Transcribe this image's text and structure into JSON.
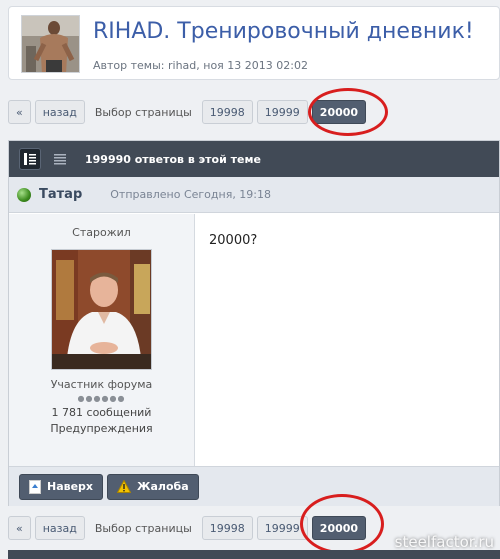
{
  "topic": {
    "title": "RIHAD. Тренировочный дневник!",
    "meta": "Автор темы: rihad, ноя 13 2013 02:02"
  },
  "pagination": {
    "first": "«",
    "prev": "назад",
    "label": "Выбор страницы",
    "pages": [
      "19998",
      "19999",
      "20000"
    ],
    "current": "20000"
  },
  "thread_bar": {
    "replies": "199990 ответов в этой теме"
  },
  "post": {
    "author": "Татар",
    "sent": "Отправлено Сегодня, 19:18",
    "rank": "Старожил",
    "group": "Участник форума",
    "rank_pips": "●●●●●●",
    "posts_count": "1 781 сообщений",
    "warnings": "Предупреждения",
    "content": "20000?",
    "online": true
  },
  "actions": {
    "top": "Наверх",
    "report": "Жалоба"
  },
  "watermark": "steelfactor.ru",
  "colors": {
    "title_blue": "#3c5ea8",
    "bar_dark": "#414a56",
    "annotation_red": "#d81e1e"
  }
}
